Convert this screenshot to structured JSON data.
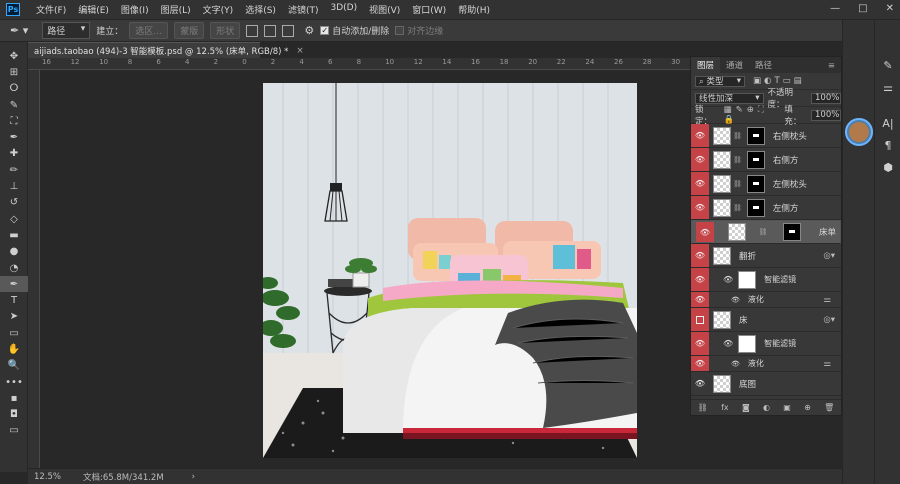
{
  "menubar": {
    "logo": "Ps",
    "items": [
      "文件(F)",
      "编辑(E)",
      "图像(I)",
      "图层(L)",
      "文字(Y)",
      "选择(S)",
      "滤镜(T)",
      "3D(D)",
      "视图(V)",
      "窗口(W)",
      "帮助(H)"
    ],
    "window_controls": [
      "—",
      "□",
      "✕"
    ]
  },
  "options_bar": {
    "tool_mode": "路径",
    "build_label": "建立：",
    "selection_btn": "选区…",
    "mask_btn": "蒙版",
    "shape_btn": "形状",
    "auto_add_delete": "自动添加/删除",
    "align_edges": "对齐边缘"
  },
  "document_tab": {
    "title": "aijiads.taobao (494)-3 智能模板.psd @ 12.5% (床单, RGB/8) *",
    "close": "×"
  },
  "ruler": {
    "top_labels": [
      "16",
      "12",
      "10",
      "8",
      "6",
      "4",
      "2",
      "0",
      "2",
      "4",
      "6",
      "8",
      "10",
      "12",
      "14",
      "16",
      "18",
      "20",
      "22",
      "24",
      "26",
      "28",
      "30",
      "32",
      "34",
      "36",
      "38",
      "40",
      "42"
    ]
  },
  "toolbar": {
    "tools": [
      "move-tool",
      "artboard-tool",
      "lasso-tool",
      "quick-select-tool",
      "crop-tool",
      "eyedropper-tool",
      "healing-brush-tool",
      "brush-tool",
      "clone-stamp-tool",
      "history-brush-tool",
      "eraser-tool",
      "gradient-tool",
      "blur-tool",
      "dodge-tool",
      "pen-tool",
      "type-tool",
      "path-select-tool",
      "rectangle-tool",
      "hand-tool",
      "zoom-tool",
      "more-tools",
      "color-swatches",
      "quick-mask",
      "screen-mode"
    ],
    "glyphs": [
      "✥",
      "⊞",
      "ⵔ",
      "✎",
      "⛶",
      "✒",
      "✚",
      "✏",
      "⊥",
      "↺",
      "◇",
      "▬",
      "●",
      "◔",
      "✒",
      "T",
      "➤",
      "▭",
      "✋",
      "🔍",
      "•••",
      "▪",
      "◘",
      "▭"
    ]
  },
  "status_bar": {
    "zoom": "12.5%",
    "doc_size": "文档:65.8M/341.2M",
    "arrow": "›"
  },
  "layers_panel": {
    "tabs": [
      "图层",
      "通道",
      "路径"
    ],
    "filter_kind": "类型",
    "blend_mode": "线性加深",
    "opacity_label": "不透明度：",
    "opacity_value": "100%",
    "lock_label": "锁定：",
    "fill_label": "填充：",
    "fill_value": "100%",
    "layers": [
      {
        "name": "右侧枕头",
        "visible": true,
        "type": "masked"
      },
      {
        "name": "右侧方",
        "visible": true,
        "type": "masked"
      },
      {
        "name": "左侧枕头",
        "visible": true,
        "type": "masked"
      },
      {
        "name": "左侧方",
        "visible": true,
        "type": "masked"
      },
      {
        "name": "床单",
        "visible": true,
        "type": "masked",
        "selected": true
      },
      {
        "name": "翻折",
        "visible": true,
        "type": "smart"
      },
      {
        "name": "智能滤镜",
        "visible": true,
        "type": "filter-mask"
      },
      {
        "name": "液化",
        "visible": true,
        "type": "filter"
      },
      {
        "name": "床",
        "visible": false,
        "type": "smart"
      },
      {
        "name": "智能滤镜",
        "visible": true,
        "type": "filter-mask"
      },
      {
        "name": "液化",
        "visible": true,
        "type": "filter"
      },
      {
        "name": "底图",
        "visible": true,
        "type": "plain"
      }
    ],
    "footer_icons": [
      "link-icon",
      "fx-icon",
      "mask-icon",
      "adjustment-icon",
      "group-icon",
      "new-layer-icon",
      "trash-icon"
    ],
    "footer_glyphs": [
      "⛓",
      "fx",
      "◙",
      "◐",
      "▣",
      "⊕",
      "🗑"
    ]
  },
  "right_dock": {
    "icons": [
      "brush-settings-icon",
      "adjustments-icon",
      "character-icon",
      "paragraph-icon",
      "3d-icon"
    ],
    "glyphs": [
      "✎",
      "⚌",
      "A|",
      "¶",
      "⬢"
    ]
  },
  "colors": {
    "accent": "#31a8ff",
    "visibility_red": "#c54246",
    "selected_layer": "#5a5a5a"
  }
}
